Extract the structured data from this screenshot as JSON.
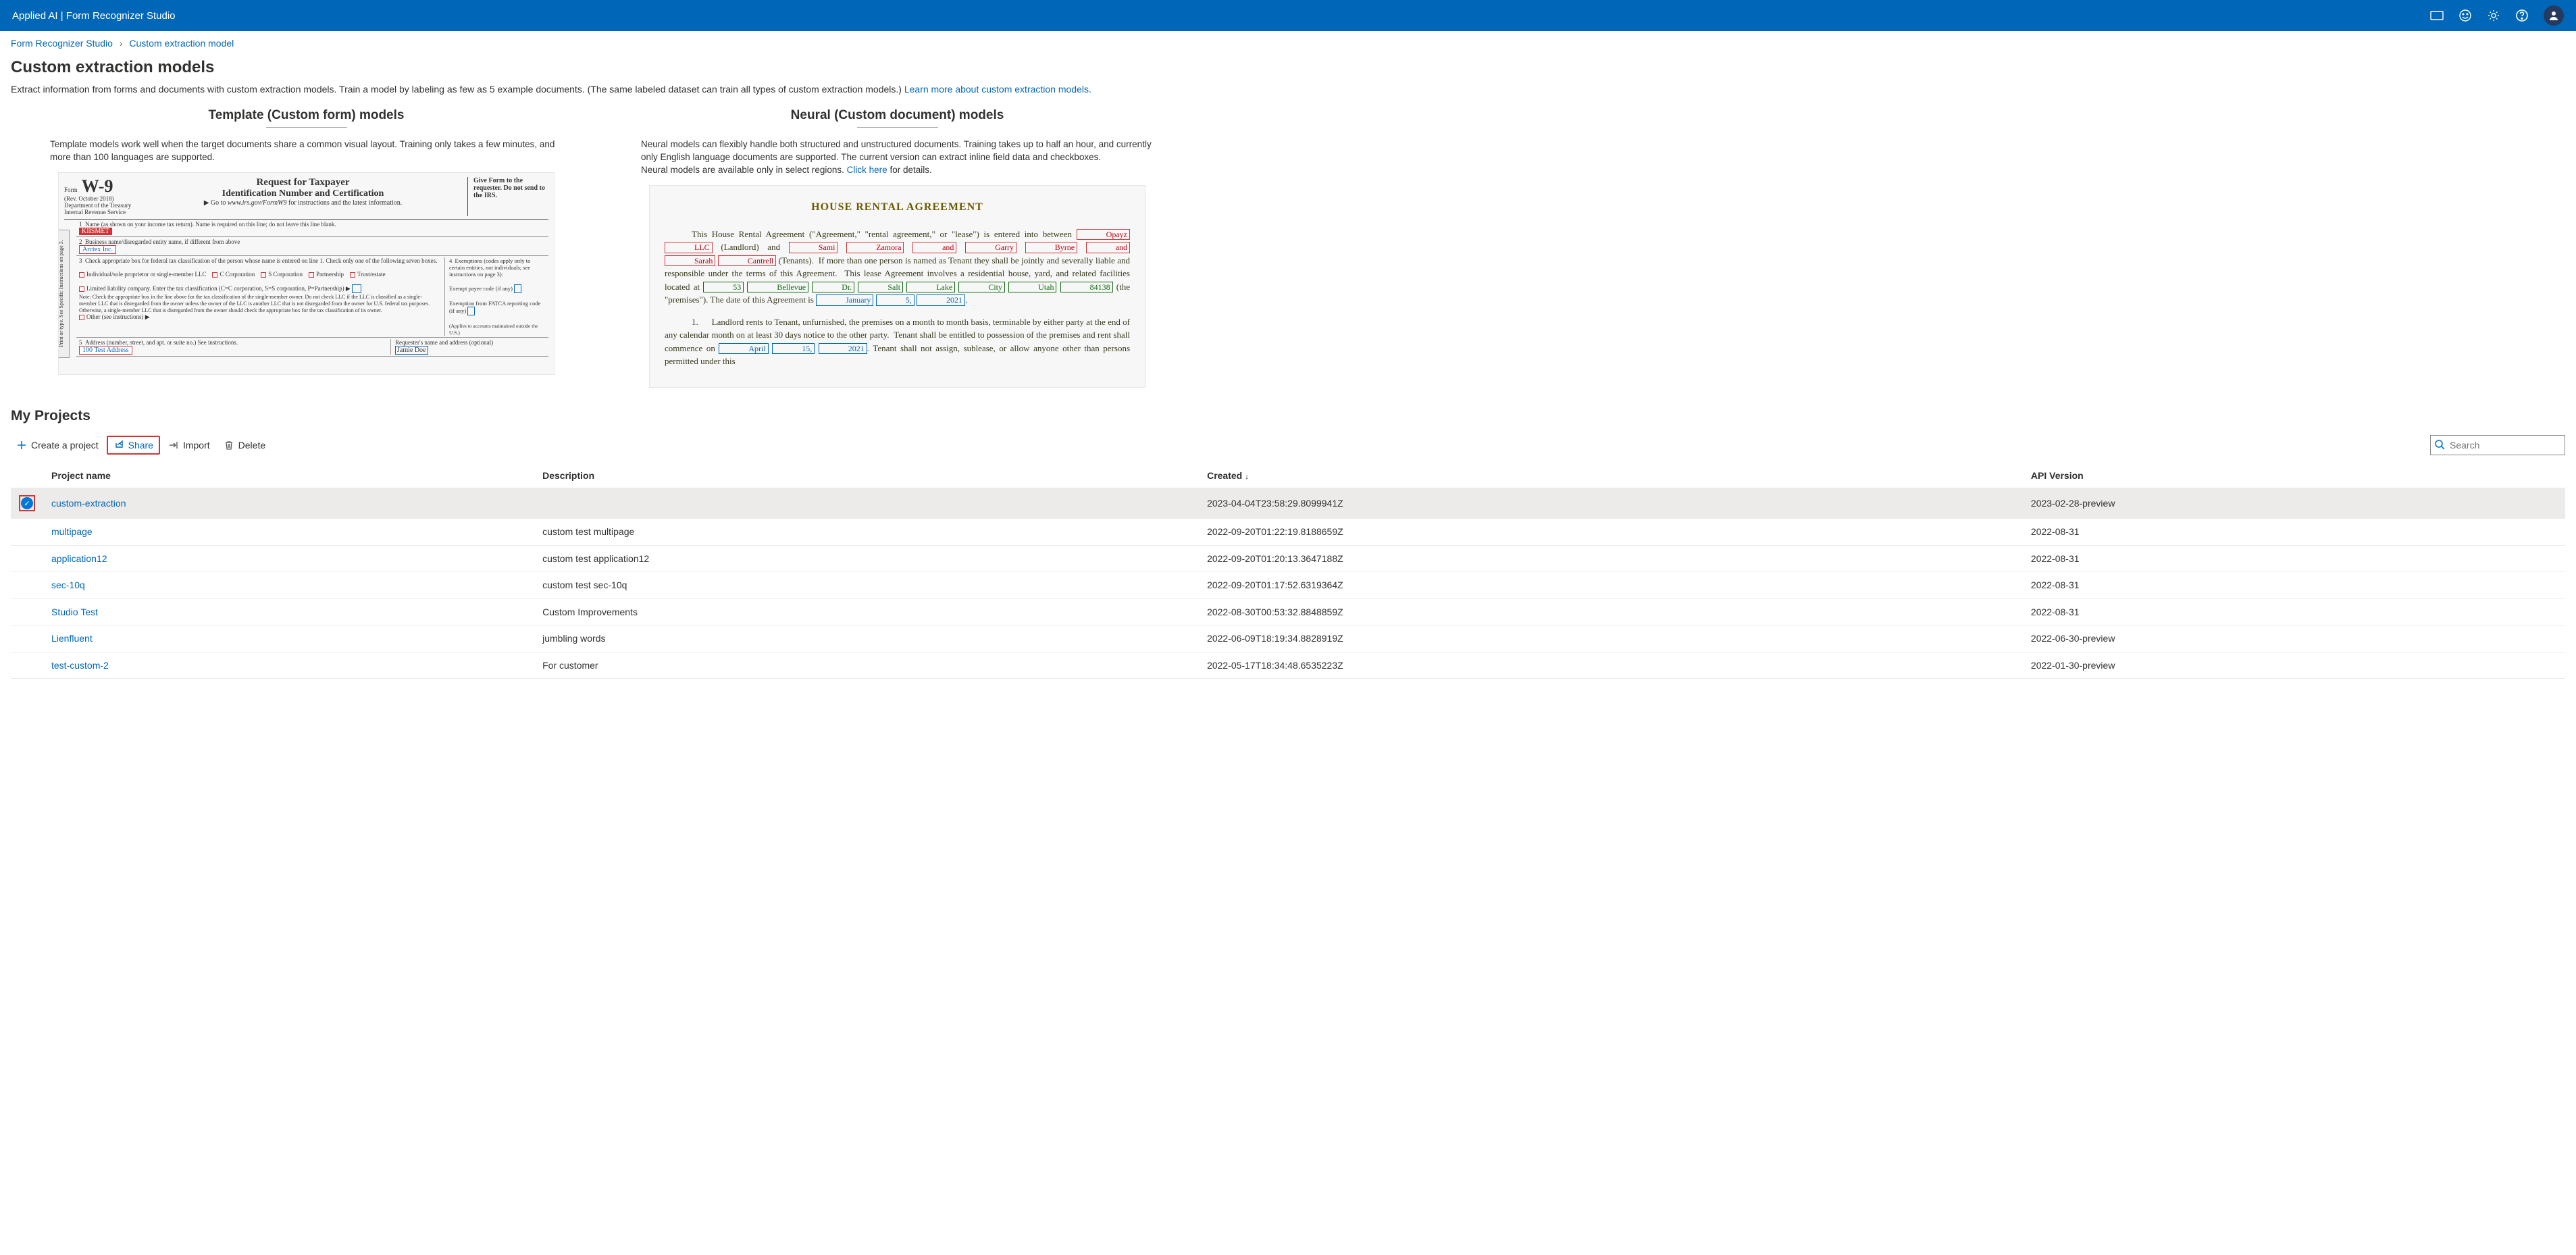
{
  "topbar": {
    "title": "Applied AI | Form Recognizer Studio"
  },
  "breadcrumb": {
    "root": "Form Recognizer Studio",
    "current": "Custom extraction model"
  },
  "page": {
    "title": "Custom extraction models",
    "intro_text": "Extract information from forms and documents with custom extraction models. Train a model by labeling as few as 5 example documents. (The same labeled dataset can train all types of custom extraction models.) ",
    "learn_more": "Learn more about custom extraction models"
  },
  "models": {
    "template": {
      "title": "Template (Custom form) models",
      "desc": "Template models work well when the target documents share a common visual layout. Training only takes a few minutes, and more than 100 languages are supported."
    },
    "neural": {
      "title": "Neural (Custom document) models",
      "desc_a": "Neural models can flexibly handle both structured and unstructured documents. Training takes up to half an hour, and currently only English language documents are supported. The current version can extract inline field data and checkboxes.",
      "desc_b": "Neural models are available only in select regions. ",
      "click_here": "Click here",
      "desc_c": " for details."
    }
  },
  "myprojects": {
    "heading": "My Projects",
    "toolbar": {
      "create": "Create a project",
      "share": "Share",
      "import": "Import",
      "delete": "Delete"
    },
    "search_placeholder": "Search",
    "columns": {
      "name": "Project name",
      "desc": "Description",
      "created": "Created",
      "api": "API Version"
    },
    "rows": [
      {
        "selected": true,
        "name": "custom-extraction",
        "desc": "",
        "created": "2023-04-04T23:58:29.8099941Z",
        "api": "2023-02-28-preview"
      },
      {
        "selected": false,
        "name": "multipage",
        "desc": "custom test multipage",
        "created": "2022-09-20T01:22:19.8188659Z",
        "api": "2022-08-31"
      },
      {
        "selected": false,
        "name": "application12",
        "desc": "custom test application12",
        "created": "2022-09-20T01:20:13.3647188Z",
        "api": "2022-08-31"
      },
      {
        "selected": false,
        "name": "sec-10q",
        "desc": "custom test sec-10q",
        "created": "2022-09-20T01:17:52.6319364Z",
        "api": "2022-08-31"
      },
      {
        "selected": false,
        "name": "Studio Test",
        "desc": "Custom Improvements",
        "created": "2022-08-30T00:53:32.8848859Z",
        "api": "2022-08-31"
      },
      {
        "selected": false,
        "name": "Lienfluent",
        "desc": "jumbling words",
        "created": "2022-06-09T18:19:34.8828919Z",
        "api": "2022-06-30-preview"
      },
      {
        "selected": false,
        "name": "test-custom-2",
        "desc": "For customer",
        "created": "2022-05-17T18:34:48.6535223Z",
        "api": "2022-01-30-preview"
      }
    ]
  }
}
